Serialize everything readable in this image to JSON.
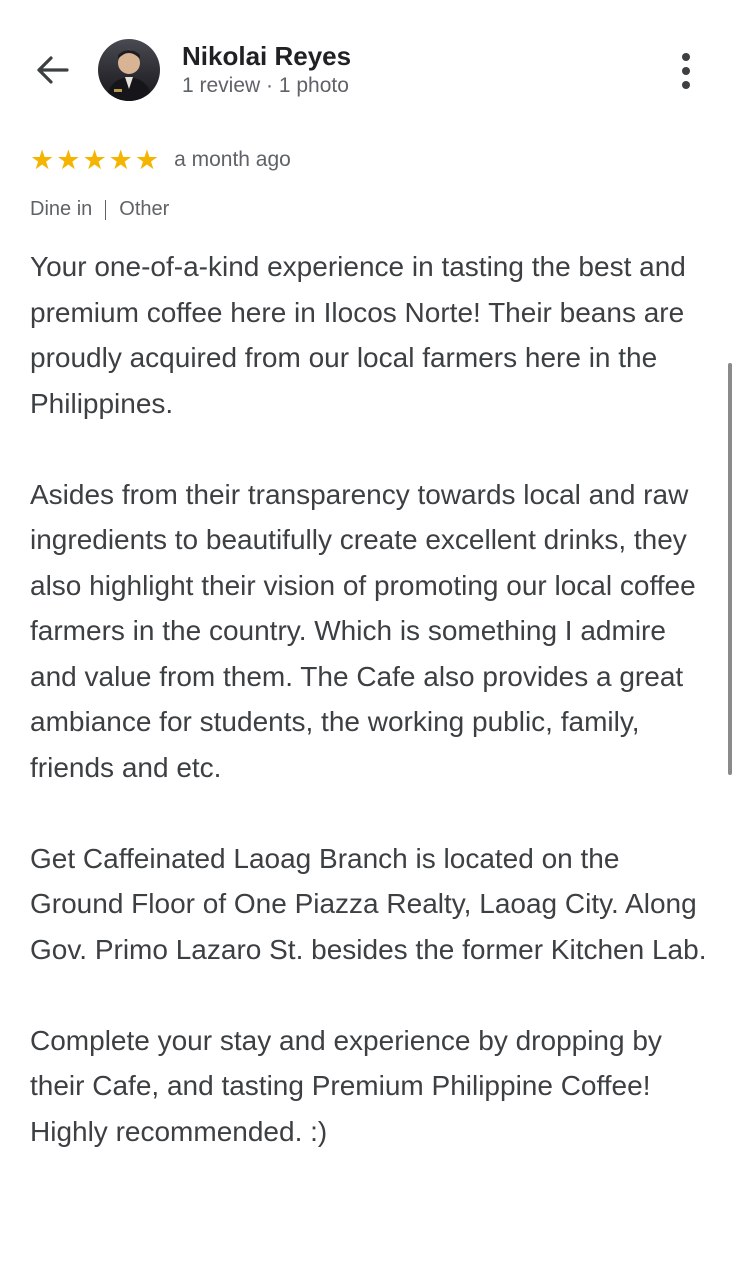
{
  "header": {
    "user_name": "Nikolai Reyes",
    "user_meta": "1 review · 1 photo",
    "icons": {
      "back": "arrow-back-icon",
      "more": "more-vert-icon"
    }
  },
  "review": {
    "rating": 5,
    "rating_max": 5,
    "time_ago": "a month ago",
    "tags": [
      "Dine in",
      "Other"
    ],
    "paragraphs": [
      "Your one-of-a-kind experience in tasting the best and premium coffee here in Ilocos Norte! Their beans are proudly acquired from our local farmers here in the Philippines.",
      "Asides from their transparency towards local and raw ingredients to beautifully create excellent drinks, they also highlight their vision of promoting our local coffee farmers in the country. Which is something I admire and value from them. The Cafe also provides a great ambiance for students, the working public, family, friends and etc.",
      "Get Caffeinated Laoag Branch is located on the Ground Floor of One Piazza Realty, Laoag City. Along Gov. Primo Lazaro St. besides the former Kitchen Lab.",
      "Complete your stay and experience by dropping by their Cafe, and tasting Premium Philippine Coffee! Highly recommended. :)"
    ]
  },
  "colors": {
    "star": "#f4b400",
    "text_primary": "#202124",
    "text_secondary": "#5f6368",
    "body_text": "#3c4043"
  }
}
